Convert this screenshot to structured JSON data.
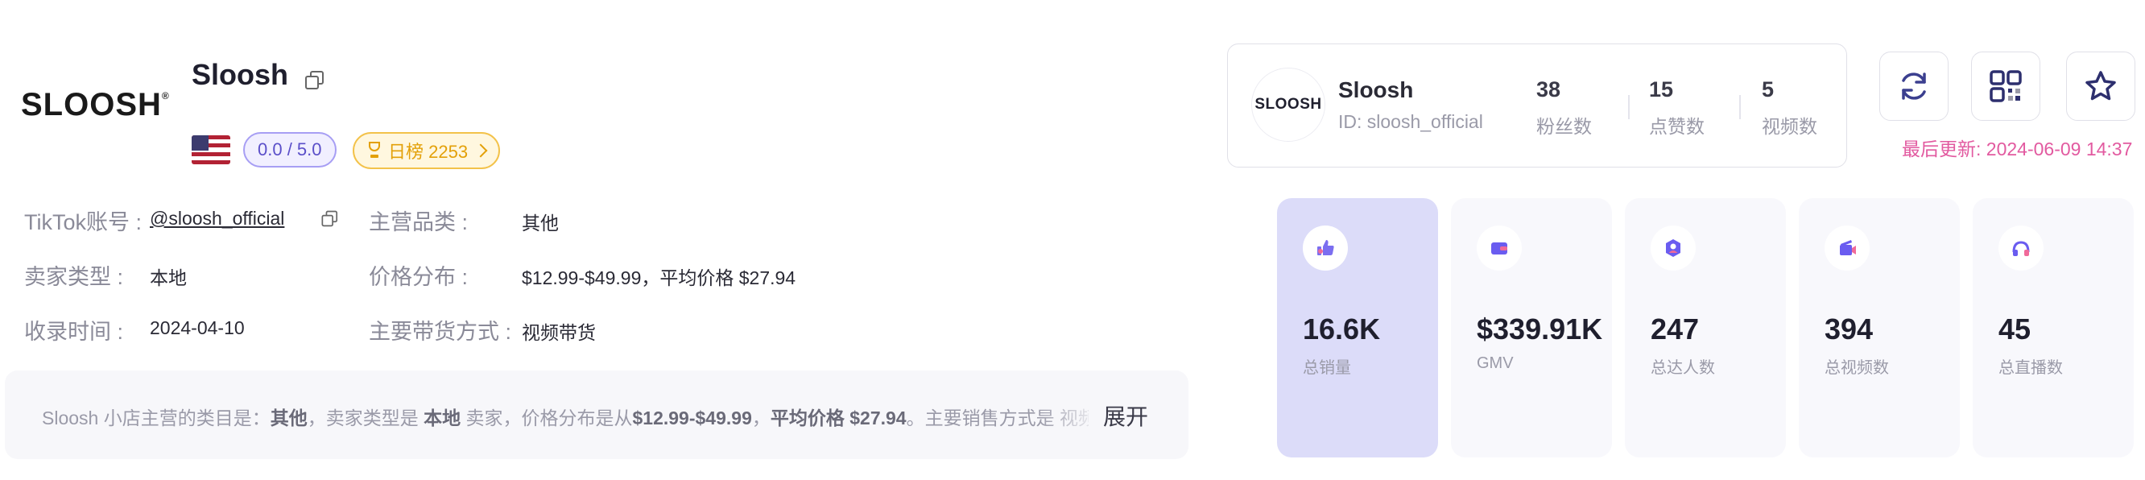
{
  "shop": {
    "logo_text": "SLOOSH",
    "name": "Sloosh",
    "rating": "0.0 / 5.0",
    "rank": "日榜 2253"
  },
  "info": {
    "tiktok_label": "TikTok账号 :",
    "tiktok_value": "@sloosh_official",
    "category_label": "主营品类 :",
    "category_value": "其他",
    "seller_type_label": "卖家类型 :",
    "seller_type_value": "本地",
    "price_label": "价格分布 :",
    "price_value": "$12.99-$49.99，平均价格 $27.94",
    "recorded_label": "收录时间 :",
    "recorded_value": "2024-04-10",
    "method_label": "主要带货方式 :",
    "method_value": "视频带货"
  },
  "description": {
    "t1": "Sloosh 小店主营的类目是：",
    "b1": "其他",
    "t2": "，卖家类型是 ",
    "b2": "本地",
    "t3": " 卖家，价格分布是从",
    "b3": "$12.99-$49.99",
    "t4": "，",
    "b4": "平均价格 $27.94",
    "t5": "。主要销售方式是 视频带货",
    "expand": "展开"
  },
  "profile": {
    "avatar_text": "SLOOSH",
    "name": "Sloosh",
    "id": "ID: sloosh_official",
    "stats": [
      {
        "value": "38",
        "label": "粉丝数"
      },
      {
        "value": "15",
        "label": "点赞数"
      },
      {
        "value": "5",
        "label": "视频数"
      }
    ]
  },
  "updated": "最后更新: 2024-06-09 14:37",
  "cards": [
    {
      "value": "16.6K",
      "label": "总销量",
      "icon": "thumbs-up-icon"
    },
    {
      "value": "$339.91K",
      "label": "GMV",
      "icon": "wallet-icon"
    },
    {
      "value": "247",
      "label": "总达人数",
      "icon": "creator-icon"
    },
    {
      "value": "394",
      "label": "总视频数",
      "icon": "video-icon"
    },
    {
      "value": "45",
      "label": "总直播数",
      "icon": "live-icon"
    }
  ],
  "colors": {
    "accent": "#5b4fc9",
    "active_card": "#dcdcf9",
    "updated": "#e25aa0",
    "rank": "#e3a008"
  }
}
